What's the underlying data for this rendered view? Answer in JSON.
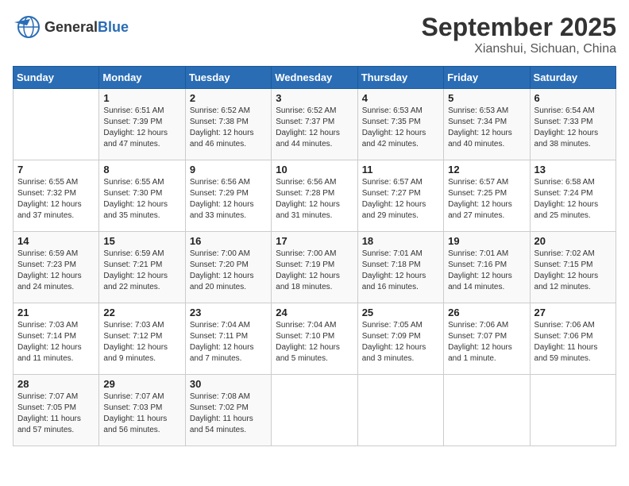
{
  "header": {
    "logo_general": "General",
    "logo_blue": "Blue",
    "month": "September 2025",
    "location": "Xianshui, Sichuan, China"
  },
  "days_of_week": [
    "Sunday",
    "Monday",
    "Tuesday",
    "Wednesday",
    "Thursday",
    "Friday",
    "Saturday"
  ],
  "weeks": [
    [
      {
        "day": "",
        "info": ""
      },
      {
        "day": "1",
        "info": "Sunrise: 6:51 AM\nSunset: 7:39 PM\nDaylight: 12 hours\nand 47 minutes."
      },
      {
        "day": "2",
        "info": "Sunrise: 6:52 AM\nSunset: 7:38 PM\nDaylight: 12 hours\nand 46 minutes."
      },
      {
        "day": "3",
        "info": "Sunrise: 6:52 AM\nSunset: 7:37 PM\nDaylight: 12 hours\nand 44 minutes."
      },
      {
        "day": "4",
        "info": "Sunrise: 6:53 AM\nSunset: 7:35 PM\nDaylight: 12 hours\nand 42 minutes."
      },
      {
        "day": "5",
        "info": "Sunrise: 6:53 AM\nSunset: 7:34 PM\nDaylight: 12 hours\nand 40 minutes."
      },
      {
        "day": "6",
        "info": "Sunrise: 6:54 AM\nSunset: 7:33 PM\nDaylight: 12 hours\nand 38 minutes."
      }
    ],
    [
      {
        "day": "7",
        "info": "Sunrise: 6:55 AM\nSunset: 7:32 PM\nDaylight: 12 hours\nand 37 minutes."
      },
      {
        "day": "8",
        "info": "Sunrise: 6:55 AM\nSunset: 7:30 PM\nDaylight: 12 hours\nand 35 minutes."
      },
      {
        "day": "9",
        "info": "Sunrise: 6:56 AM\nSunset: 7:29 PM\nDaylight: 12 hours\nand 33 minutes."
      },
      {
        "day": "10",
        "info": "Sunrise: 6:56 AM\nSunset: 7:28 PM\nDaylight: 12 hours\nand 31 minutes."
      },
      {
        "day": "11",
        "info": "Sunrise: 6:57 AM\nSunset: 7:27 PM\nDaylight: 12 hours\nand 29 minutes."
      },
      {
        "day": "12",
        "info": "Sunrise: 6:57 AM\nSunset: 7:25 PM\nDaylight: 12 hours\nand 27 minutes."
      },
      {
        "day": "13",
        "info": "Sunrise: 6:58 AM\nSunset: 7:24 PM\nDaylight: 12 hours\nand 25 minutes."
      }
    ],
    [
      {
        "day": "14",
        "info": "Sunrise: 6:59 AM\nSunset: 7:23 PM\nDaylight: 12 hours\nand 24 minutes."
      },
      {
        "day": "15",
        "info": "Sunrise: 6:59 AM\nSunset: 7:21 PM\nDaylight: 12 hours\nand 22 minutes."
      },
      {
        "day": "16",
        "info": "Sunrise: 7:00 AM\nSunset: 7:20 PM\nDaylight: 12 hours\nand 20 minutes."
      },
      {
        "day": "17",
        "info": "Sunrise: 7:00 AM\nSunset: 7:19 PM\nDaylight: 12 hours\nand 18 minutes."
      },
      {
        "day": "18",
        "info": "Sunrise: 7:01 AM\nSunset: 7:18 PM\nDaylight: 12 hours\nand 16 minutes."
      },
      {
        "day": "19",
        "info": "Sunrise: 7:01 AM\nSunset: 7:16 PM\nDaylight: 12 hours\nand 14 minutes."
      },
      {
        "day": "20",
        "info": "Sunrise: 7:02 AM\nSunset: 7:15 PM\nDaylight: 12 hours\nand 12 minutes."
      }
    ],
    [
      {
        "day": "21",
        "info": "Sunrise: 7:03 AM\nSunset: 7:14 PM\nDaylight: 12 hours\nand 11 minutes."
      },
      {
        "day": "22",
        "info": "Sunrise: 7:03 AM\nSunset: 7:12 PM\nDaylight: 12 hours\nand 9 minutes."
      },
      {
        "day": "23",
        "info": "Sunrise: 7:04 AM\nSunset: 7:11 PM\nDaylight: 12 hours\nand 7 minutes."
      },
      {
        "day": "24",
        "info": "Sunrise: 7:04 AM\nSunset: 7:10 PM\nDaylight: 12 hours\nand 5 minutes."
      },
      {
        "day": "25",
        "info": "Sunrise: 7:05 AM\nSunset: 7:09 PM\nDaylight: 12 hours\nand 3 minutes."
      },
      {
        "day": "26",
        "info": "Sunrise: 7:06 AM\nSunset: 7:07 PM\nDaylight: 12 hours\nand 1 minute."
      },
      {
        "day": "27",
        "info": "Sunrise: 7:06 AM\nSunset: 7:06 PM\nDaylight: 11 hours\nand 59 minutes."
      }
    ],
    [
      {
        "day": "28",
        "info": "Sunrise: 7:07 AM\nSunset: 7:05 PM\nDaylight: 11 hours\nand 57 minutes."
      },
      {
        "day": "29",
        "info": "Sunrise: 7:07 AM\nSunset: 7:03 PM\nDaylight: 11 hours\nand 56 minutes."
      },
      {
        "day": "30",
        "info": "Sunrise: 7:08 AM\nSunset: 7:02 PM\nDaylight: 11 hours\nand 54 minutes."
      },
      {
        "day": "",
        "info": ""
      },
      {
        "day": "",
        "info": ""
      },
      {
        "day": "",
        "info": ""
      },
      {
        "day": "",
        "info": ""
      }
    ]
  ]
}
